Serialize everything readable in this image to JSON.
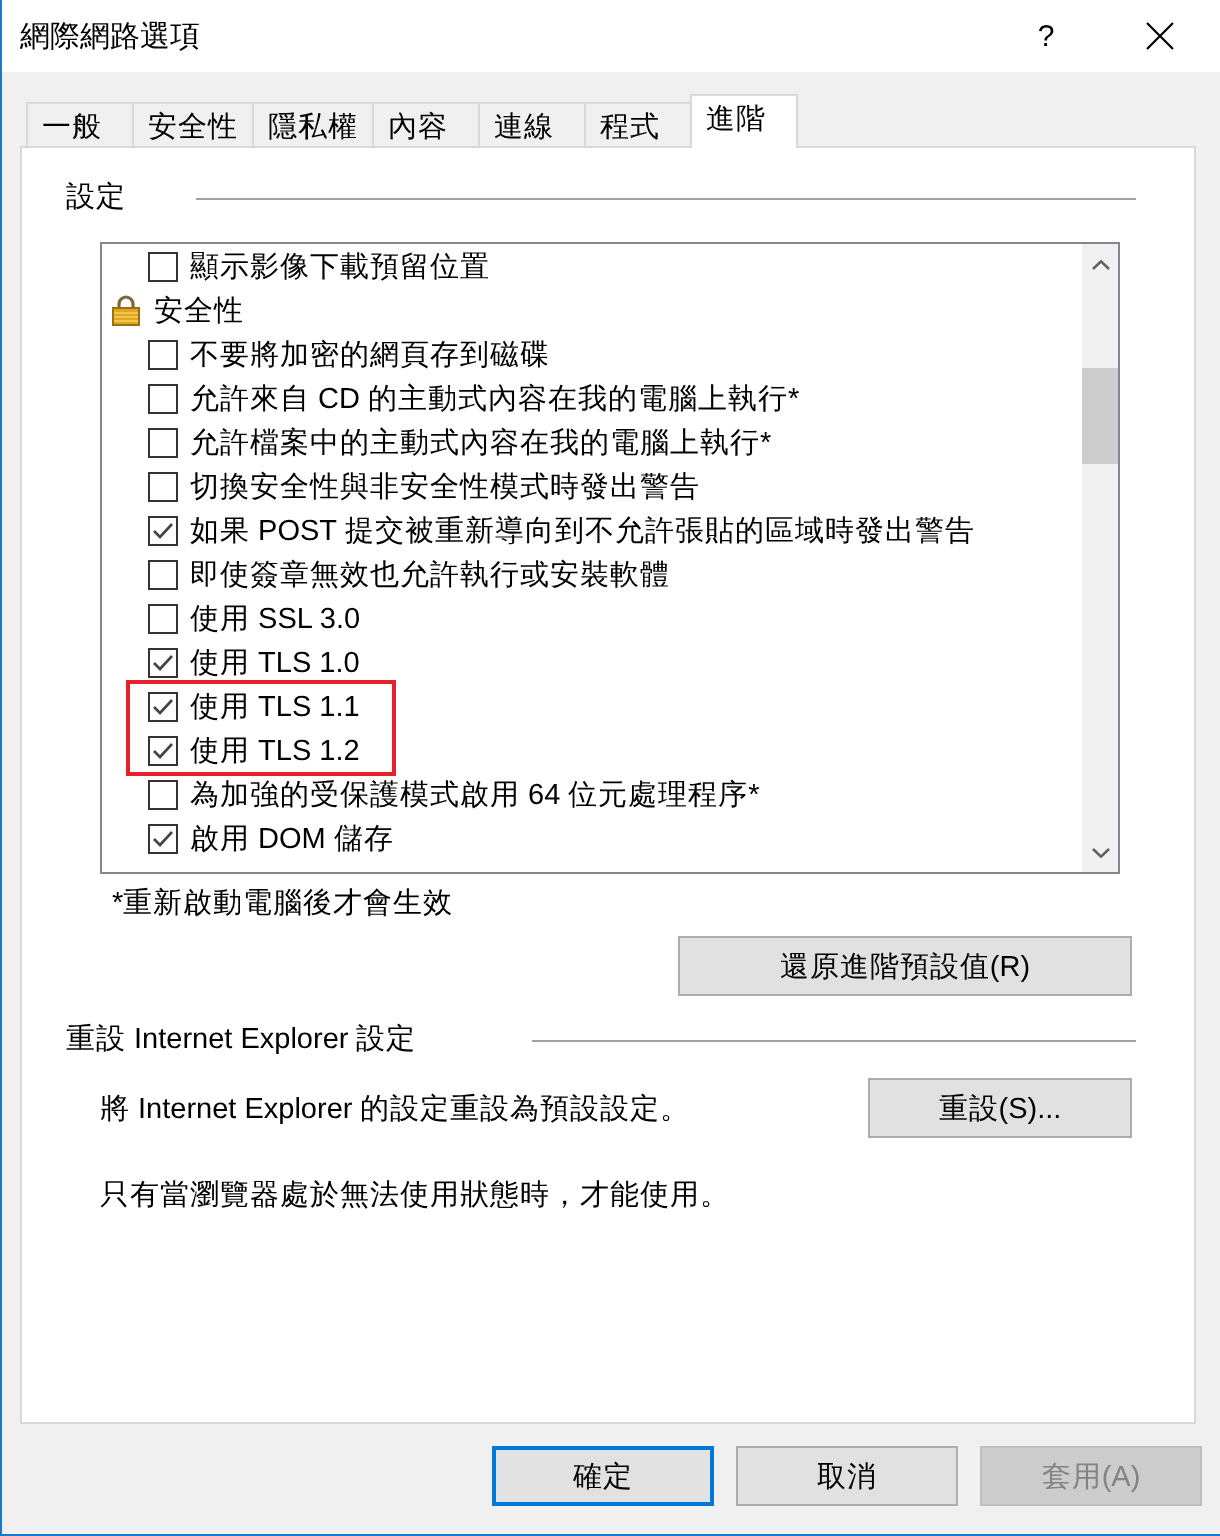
{
  "window": {
    "title": "網際網路選項",
    "help_button": "?"
  },
  "tabs": [
    {
      "label": "一般",
      "selected": false
    },
    {
      "label": "安全性",
      "selected": false
    },
    {
      "label": "隱私權",
      "selected": false
    },
    {
      "label": "內容",
      "selected": false
    },
    {
      "label": "連線",
      "selected": false
    },
    {
      "label": "程式",
      "selected": false
    },
    {
      "label": "進階",
      "selected": true
    }
  ],
  "settings": {
    "heading": "設定",
    "items": [
      {
        "kind": "checkbox",
        "label": "顯示影像下載預留位置",
        "checked": false,
        "highlighted": false
      },
      {
        "kind": "category",
        "label": "安全性",
        "highlighted": false
      },
      {
        "kind": "checkbox",
        "label": "不要將加密的網頁存到磁碟",
        "checked": false,
        "highlighted": false
      },
      {
        "kind": "checkbox",
        "label": "允許來自 CD 的主動式內容在我的電腦上執行*",
        "checked": false,
        "highlighted": false
      },
      {
        "kind": "checkbox",
        "label": "允許檔案中的主動式內容在我的電腦上執行*",
        "checked": false,
        "highlighted": false
      },
      {
        "kind": "checkbox",
        "label": "切換安全性與非安全性模式時發出警告",
        "checked": false,
        "highlighted": false
      },
      {
        "kind": "checkbox",
        "label": "如果 POST 提交被重新導向到不允許張貼的區域時發出警告",
        "checked": true,
        "highlighted": false
      },
      {
        "kind": "checkbox",
        "label": "即使簽章無效也允許執行或安裝軟體",
        "checked": false,
        "highlighted": false
      },
      {
        "kind": "checkbox",
        "label": "使用 SSL 3.0",
        "checked": false,
        "highlighted": false
      },
      {
        "kind": "checkbox",
        "label": "使用 TLS 1.0",
        "checked": true,
        "highlighted": false
      },
      {
        "kind": "checkbox",
        "label": "使用 TLS 1.1",
        "checked": true,
        "highlighted": true
      },
      {
        "kind": "checkbox",
        "label": "使用 TLS 1.2",
        "checked": true,
        "highlighted": true
      },
      {
        "kind": "checkbox",
        "label": "為加強的受保護模式啟用 64 位元處理程序*",
        "checked": false,
        "highlighted": false
      },
      {
        "kind": "checkbox",
        "label": "啟用 DOM 儲存",
        "checked": true,
        "highlighted": false
      }
    ],
    "note": "*重新啟動電腦後才會生效",
    "restore_button": "還原進階預設值(R)"
  },
  "reset": {
    "heading": "重設 Internet Explorer 設定",
    "description": "將 Internet Explorer 的設定重設為預設設定。",
    "button": "重設(S)...",
    "note": "只有當瀏覽器處於無法使用狀態時，才能使用。"
  },
  "buttons": [
    {
      "label": "確定",
      "default": true,
      "disabled": false
    },
    {
      "label": "取消",
      "default": false,
      "disabled": false
    },
    {
      "label": "套用(A)",
      "default": false,
      "disabled": true
    }
  ]
}
